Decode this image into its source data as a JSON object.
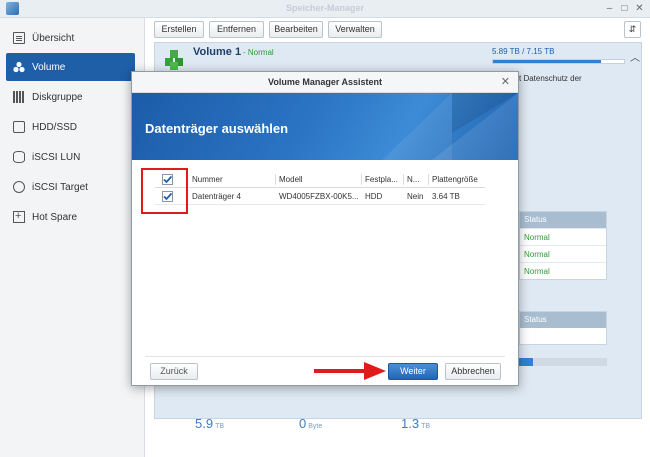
{
  "window": {
    "title": "Speicher-Manager"
  },
  "sidebar": {
    "items": [
      {
        "label": "Übersicht",
        "icon": "overview-icon"
      },
      {
        "label": "Volume",
        "icon": "volume-icon",
        "active": true
      },
      {
        "label": "Diskgruppe",
        "icon": "diskgroup-icon"
      },
      {
        "label": "HDD/SSD",
        "icon": "hdd-icon"
      },
      {
        "label": "iSCSI LUN",
        "icon": "iscsi-lun-icon"
      },
      {
        "label": "iSCSI Target",
        "icon": "iscsi-target-icon"
      },
      {
        "label": "Hot Spare",
        "icon": "hot-spare-icon"
      }
    ]
  },
  "toolbar": {
    "create": "Erstellen",
    "remove": "Entfernen",
    "edit": "Bearbeiten",
    "manage": "Verwalten"
  },
  "volume": {
    "title": "Volume 1",
    "status": "- Normal",
    "usage": "5.89 TB / 7.15 TB",
    "usage_fraction": 0.824,
    "desc_fragment": "t Datenschutz der",
    "status_header_1": "Status",
    "status_rows": [
      "Normal",
      "Normal",
      "Normal"
    ],
    "status_header_2": "Status",
    "stats": [
      {
        "value": "5.9",
        "unit": "TB"
      },
      {
        "value": "0",
        "unit": "Byte"
      },
      {
        "value": "1.3",
        "unit": "TB"
      }
    ]
  },
  "dialog": {
    "title": "Volume Manager Assistent",
    "heading": "Datenträger auswählen",
    "columns": [
      "Nummer",
      "Modell",
      "Festpla...",
      "N...",
      "Plattengröße"
    ],
    "rows": [
      {
        "number": "Datenträger 4",
        "model": "WD4005FZBX-00K5...",
        "type": "HDD",
        "n": "Nein",
        "size": "3.64 TB",
        "checked": true
      }
    ],
    "buttons": {
      "back": "Zurück",
      "next": "Weiter",
      "cancel": "Abbrechen"
    }
  },
  "colors": {
    "accent": "#1e5fa8",
    "status_ok": "#2e9a3a",
    "annotation": "#e01b1b"
  }
}
